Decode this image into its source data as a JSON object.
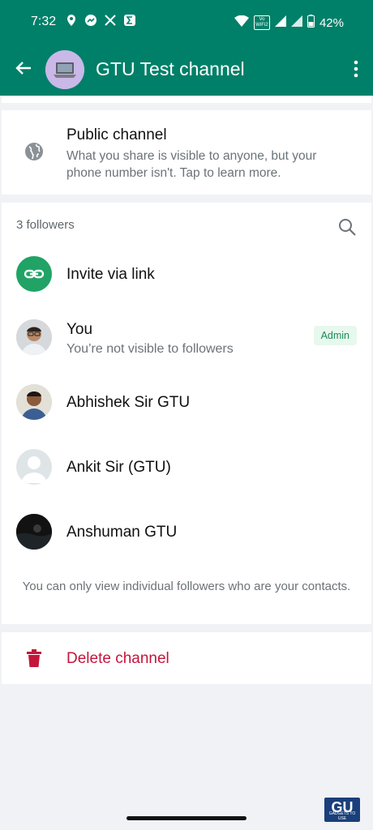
{
  "status_bar": {
    "time": "7:32",
    "network_badge": "Vo\nWiFi2",
    "battery": "42%",
    "icons": [
      "location-pin-icon",
      "messenger-icon",
      "x-icon",
      "sigma-icon",
      "wifi-icon",
      "signal-icon",
      "signal-icon",
      "battery-icon"
    ]
  },
  "app_bar": {
    "title": "GTU Test channel",
    "colors": {
      "background": "#008069",
      "foreground": "#ffffff"
    }
  },
  "public_card": {
    "title": "Public channel",
    "description": "What you share is visible to anyone, but your phone number isn't. Tap to learn more."
  },
  "followers": {
    "count_label": "3 followers",
    "items": [
      {
        "name": "Invite via link"
      },
      {
        "name": "You",
        "subtitle": "You’re not visible to followers",
        "badge": "Admin"
      },
      {
        "name": "Abhishek Sir GTU"
      },
      {
        "name": "Ankit Sir (GTU)"
      },
      {
        "name": "Anshuman GTU"
      }
    ],
    "note": "You can only view individual followers who are your contacts."
  },
  "delete": {
    "label": "Delete channel",
    "color": "#c4153b"
  },
  "watermark": {
    "logo": "GU",
    "text": "GADGETS TO USE"
  }
}
